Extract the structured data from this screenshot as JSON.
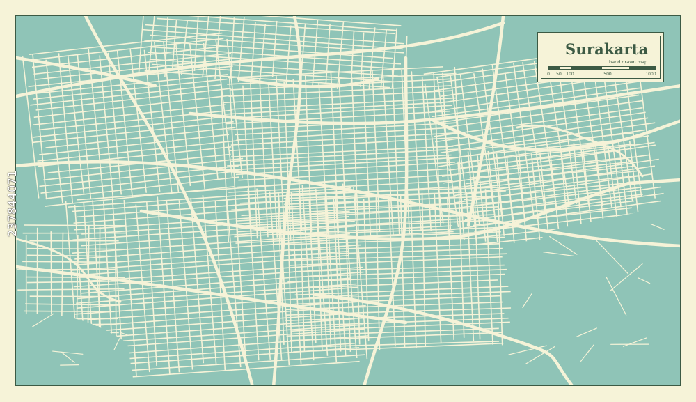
{
  "map": {
    "title": "Surakarta",
    "subtitle": "hand drawn map",
    "scale_labels": [
      "0",
      "50",
      "100",
      "500",
      "1000"
    ],
    "scale_values": [
      0,
      50,
      100,
      500,
      1000
    ]
  },
  "colors": {
    "background": "#f6f3d8",
    "block": "#8fc4b7",
    "road": "#f6f3d8",
    "border": "#3c5a44"
  },
  "stock_id": "237844071"
}
